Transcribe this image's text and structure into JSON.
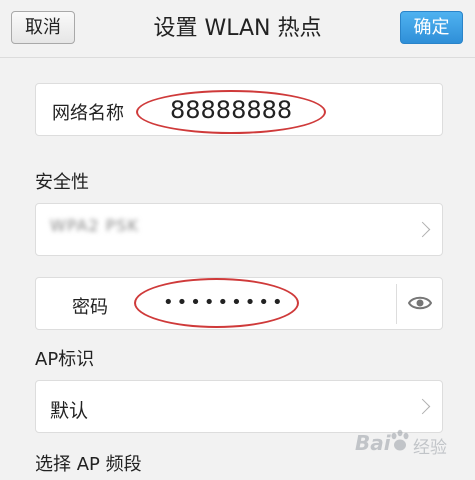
{
  "header": {
    "cancel_label": "取消",
    "title": "设置 WLAN 热点",
    "confirm_label": "确定"
  },
  "network": {
    "label": "网络名称",
    "value": "88888888"
  },
  "security": {
    "section_label": "安全性",
    "value": "WPA2 PSK"
  },
  "password": {
    "label": "密码",
    "masked_value": "•••••••••"
  },
  "ap_id": {
    "section_label": "AP标识",
    "value": "默认"
  },
  "band": {
    "section_label": "选择 AP 频段"
  },
  "watermark": {
    "brand": "Bai",
    "brand_suffix": "经验"
  },
  "icons": {
    "eye": "eye-icon",
    "chevron": "chevron-right-icon"
  },
  "colors": {
    "accent": "#3a9de3",
    "annotation": "#cf3a3a"
  }
}
